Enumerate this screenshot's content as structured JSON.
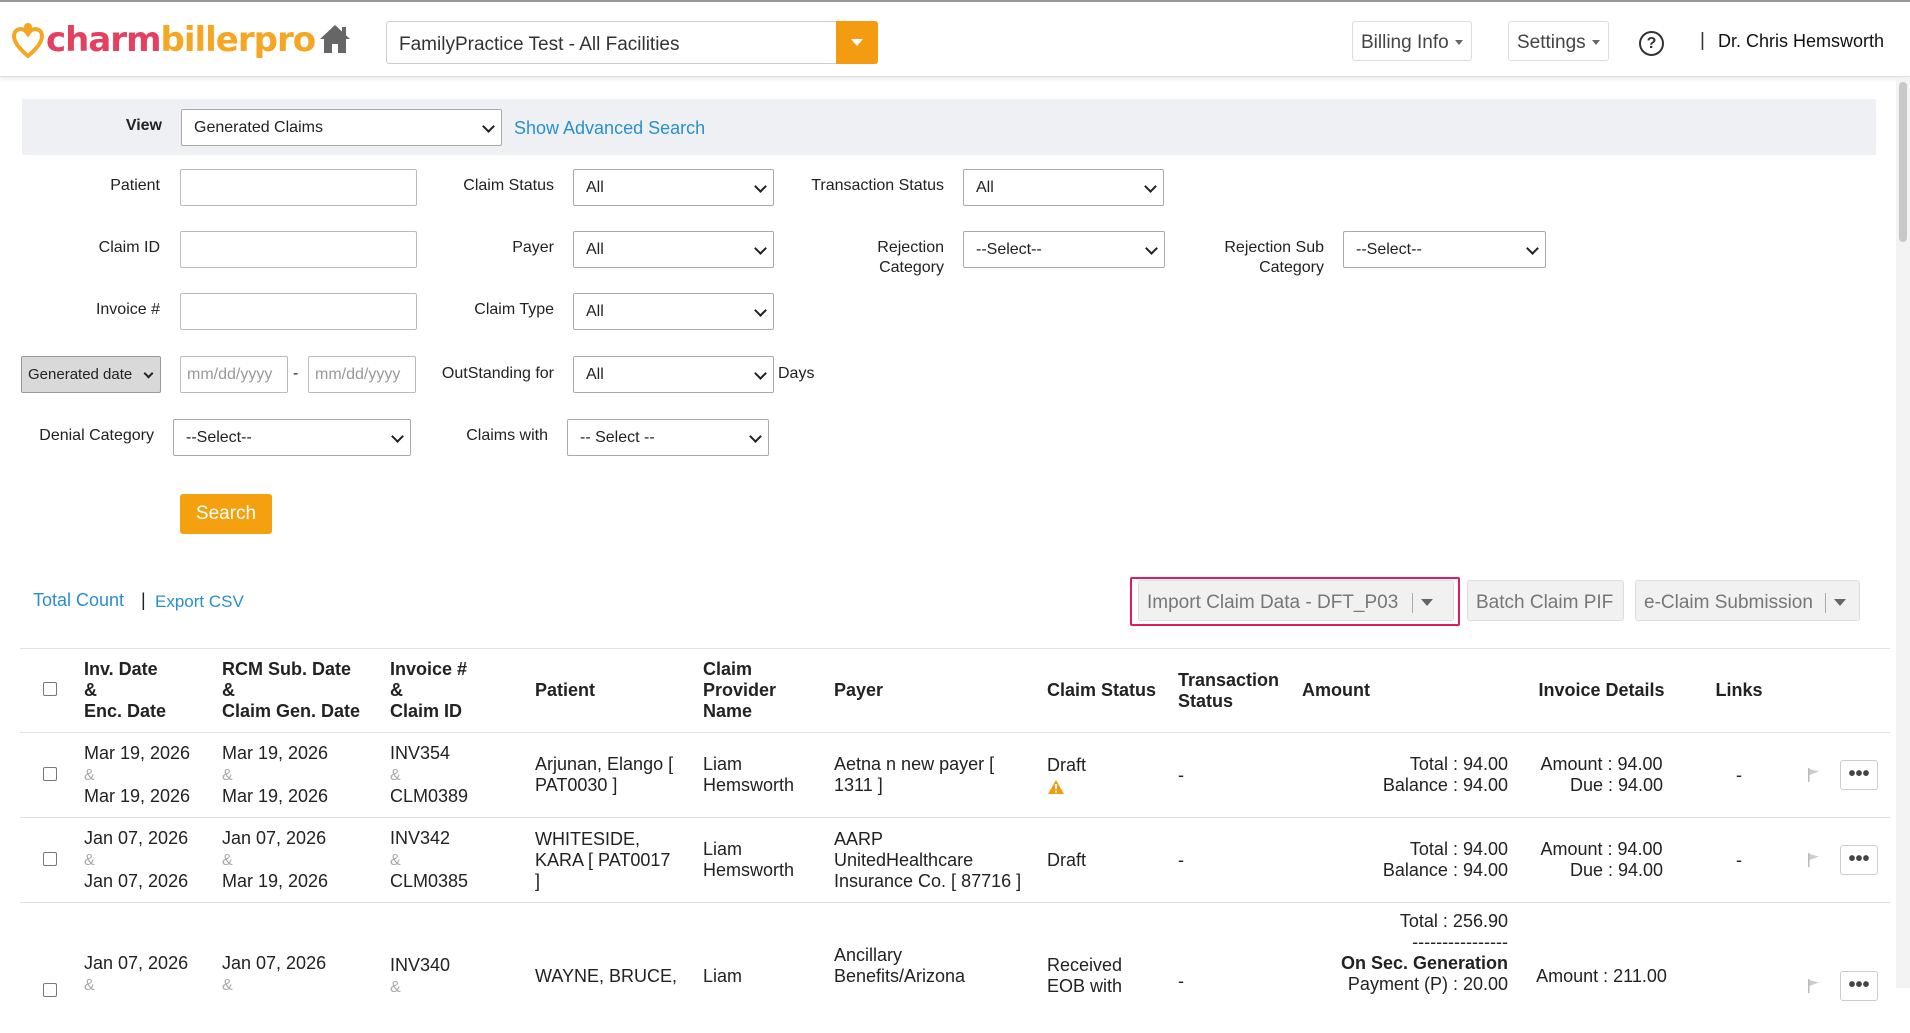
{
  "header": {
    "logo": {
      "part1": "charm",
      "part2": "billerpro"
    },
    "facility": "FamilyPractice Test - All Facilities",
    "billing_info": "Billing Info",
    "settings": "Settings",
    "help": "?",
    "separator": "|",
    "user": "Dr. Chris Hemsworth"
  },
  "filters": {
    "view_label": "View",
    "view_value": "Generated Claims",
    "advanced_search": "Show Advanced Search",
    "patient_label": "Patient",
    "claim_status_label": "Claim Status",
    "claim_status_value": "All",
    "transaction_status_label": "Transaction Status",
    "transaction_status_value": "All",
    "claim_id_label": "Claim ID",
    "payer_label": "Payer",
    "payer_value": "All",
    "rejection_category_label_1": "Rejection",
    "rejection_category_label_2": "Category",
    "rejection_category_value": "--Select--",
    "rejection_sub_label_1": "Rejection Sub",
    "rejection_sub_label_2": "Category",
    "rejection_sub_value": "--Select--",
    "invoice_label": "Invoice #",
    "claim_type_label": "Claim Type",
    "claim_type_value": "All",
    "date_type_value": "Generated date",
    "date_from_placeholder": "mm/dd/yyyy",
    "date_dash": "-",
    "date_to_placeholder": "mm/dd/yyyy",
    "outstanding_label": "OutStanding for",
    "outstanding_value": "All",
    "days_label": "Days",
    "denial_label": "Denial Category",
    "denial_value": "--Select--",
    "claims_with_label": "Claims with",
    "claims_with_value": "-- Select --",
    "search_button": "Search"
  },
  "toolbar": {
    "total_count": "Total Count",
    "separator": "|",
    "export_csv": "Export CSV",
    "import_claim": "Import Claim Data - DFT_P03",
    "batch_claim": "Batch Claim PIF",
    "eclaim": "e-Claim Submission"
  },
  "table": {
    "headers": {
      "inv_date_1": "Inv. Date",
      "inv_date_2": "&",
      "inv_date_3": "Enc. Date",
      "rcm_1": "RCM Sub. Date",
      "rcm_2": "&",
      "rcm_3": "Claim Gen. Date",
      "invoice_1": "Invoice #",
      "invoice_2": "&",
      "invoice_3": "Claim ID",
      "patient": "Patient",
      "provider_1": "Claim",
      "provider_2": "Provider",
      "provider_3": "Name",
      "payer": "Payer",
      "claim_status": "Claim Status",
      "transaction_1": "Transaction",
      "transaction_2": "Status",
      "amount": "Amount",
      "invoice_details": "Invoice Details",
      "links": "Links"
    },
    "rows": [
      {
        "inv_date": "Mar 19, 2026",
        "amp": "&",
        "enc_date": "Mar 19, 2026",
        "rcm_date": "Mar 19, 2026",
        "gen_date": "Mar 19, 2026",
        "invoice": "INV354",
        "claim_id": "CLM0389",
        "patient_1": "Arjunan, Elango [",
        "patient_2": "PAT0030 ]",
        "provider_1": "Liam",
        "provider_2": "Hemsworth",
        "payer_1": "Aetna n new payer [",
        "payer_2": "1311 ]",
        "payer_3": "",
        "status": "Draft",
        "transaction": "-",
        "total": "Total : 94.00",
        "balance": "Balance : 94.00",
        "inv_amount": "Amount : 94.00",
        "inv_due": "Due : 94.00",
        "links": "-",
        "more": "•••"
      },
      {
        "inv_date": "Jan 07, 2026",
        "amp": "&",
        "enc_date": "Jan 07, 2026",
        "rcm_date": "Jan 07, 2026",
        "gen_date": "Mar 19, 2026",
        "invoice": "INV342",
        "claim_id": "CLM0385",
        "patient_1": "WHITESIDE,",
        "patient_2": "KARA [ PAT0017",
        "patient_3": "]",
        "provider_1": "Liam",
        "provider_2": "Hemsworth",
        "payer_1": "AARP",
        "payer_2": "UnitedHealthcare",
        "payer_3": "Insurance Co. [ 87716 ]",
        "status": "Draft",
        "transaction": "-",
        "total": "Total : 94.00",
        "balance": "Balance : 94.00",
        "inv_amount": "Amount : 94.00",
        "inv_due": "Due : 94.00",
        "links": "-",
        "more": "•••"
      },
      {
        "inv_date": "Jan 07, 2026",
        "amp": "&",
        "rcm_date": "Jan 07, 2026",
        "invoice": "INV340",
        "patient_1": "WAYNE, BRUCE,",
        "provider_1": "Liam",
        "payer_1": "Ancillary",
        "payer_2": "Benefits/Arizona",
        "status_1": "Received",
        "status_2": "EOB with",
        "transaction": "-",
        "total": "Total : 256.90",
        "dashes": "----------------",
        "sec_gen": "On Sec. Generation",
        "payment": "Payment (P) : 20.00",
        "inv_amount": "Amount : 211.00",
        "more": "•••"
      }
    ]
  }
}
